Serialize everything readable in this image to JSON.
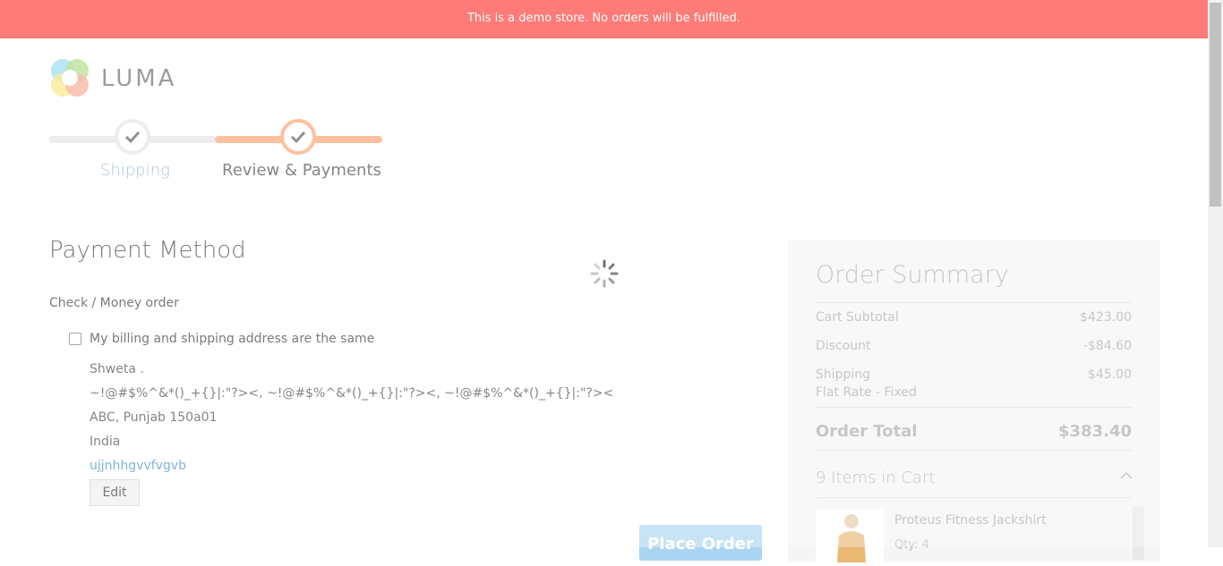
{
  "notice": {
    "text": "This is a demo store. No orders will be fulfilled."
  },
  "brand": {
    "name": "LUMA",
    "logo_icon": "luma-logo-icon"
  },
  "progress": {
    "steps": [
      {
        "label": "Shipping",
        "state": "complete"
      },
      {
        "label": "Review & Payments",
        "state": "active"
      }
    ],
    "colors": {
      "active": "#ff9e6c",
      "inactive": "#e4e4e4",
      "complete_label": "#7aa5c7"
    }
  },
  "payment": {
    "title": "Payment Method",
    "method": "Check / Money order",
    "same_address_label": "My billing and shipping address are the same",
    "same_address_checked": false,
    "address": {
      "name": "Shweta .",
      "street": "~!@#$%^&*()_+{}|:\"?><, ~!@#$%^&*()_+{}|:\"?><, ~!@#$%^&*()_+{}|:\"?><",
      "city_line": "ABC, Punjab 150a01",
      "country": "India",
      "phone": "ujjnhhgvvfvgvb"
    },
    "edit_label": "Edit",
    "place_order_label": "Place Order"
  },
  "summary": {
    "title": "Order Summary",
    "rows": [
      {
        "label": "Cart Subtotal",
        "value": "$423.00"
      },
      {
        "label": "Discount",
        "value": "-$84.60"
      },
      {
        "label": "Shipping",
        "value": "$45.00",
        "sub": "Flat Rate - Fixed"
      }
    ],
    "total_label": "Order Total",
    "total_value": "$383.40",
    "items_title": "9 Items in Cart",
    "items": [
      {
        "name": "Proteus Fitness Jackshirt",
        "qty": "Qty: 4"
      }
    ]
  },
  "loading": true
}
